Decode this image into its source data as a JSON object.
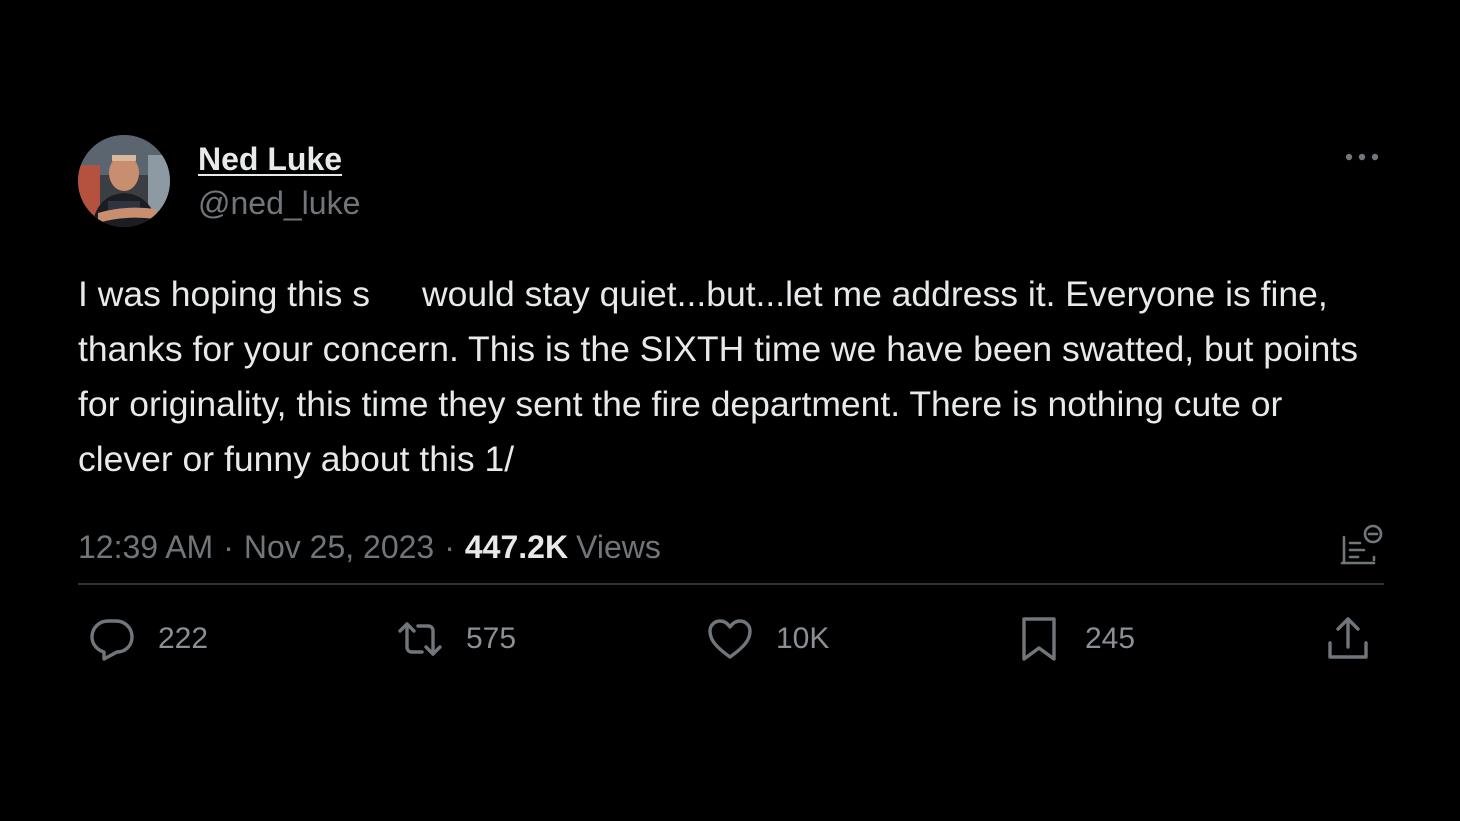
{
  "tweet": {
    "author": {
      "display_name": "Ned Luke",
      "handle": "@ned_luke",
      "avatar": "profile-photo"
    },
    "text_part1": "I was hoping this s",
    "text_part2": "would stay quiet...but...let me address it. Everyone is fine, thanks for your concern. This is the SIXTH time we have been swatted, but points for originality, this time they sent the fire department. There is nothing cute or clever or funny about this 1/",
    "time": "12:39 AM",
    "separator": "·",
    "date": "Nov 25, 2023",
    "views_count": "447.2K",
    "views_label": "Views"
  },
  "actions": {
    "reply_count": "222",
    "retweet_count": "575",
    "like_count": "10K",
    "bookmark_count": "245"
  },
  "icons": {
    "more": "more-horizontal-icon",
    "analytics": "analytics-icon",
    "reply": "reply-icon",
    "retweet": "retweet-icon",
    "like": "heart-icon",
    "bookmark": "bookmark-icon",
    "share": "share-icon"
  },
  "colors": {
    "background": "#000000",
    "primary_text": "#e7e9ea",
    "secondary_text": "#71767b",
    "divider": "#2f3336"
  }
}
